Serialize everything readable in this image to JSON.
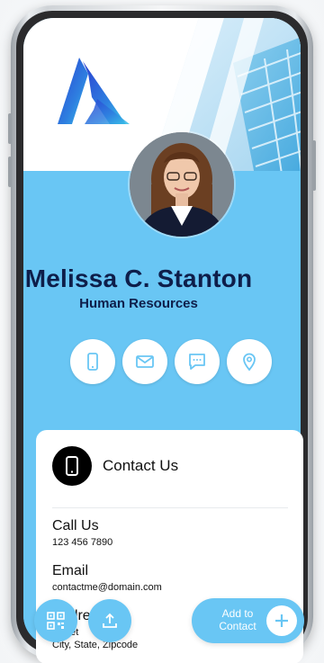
{
  "profile": {
    "name": "Melissa C. Stanton",
    "role": "Human Resources"
  },
  "actions": [
    {
      "icon": "phone-icon"
    },
    {
      "icon": "mail-icon"
    },
    {
      "icon": "chat-icon"
    },
    {
      "icon": "location-pin-icon"
    }
  ],
  "contact_card": {
    "title": "Contact Us",
    "call_label": "Call Us",
    "call_value": "123 456 7890",
    "email_label": "Email",
    "email_value": "contactme@domain.com",
    "address_label": "Address",
    "address_street": "Street",
    "address_city": "City, State, Zipcode"
  },
  "bottom_bar": {
    "add_contact_label": "Add to Contact"
  },
  "colors": {
    "accent": "#69c6f4",
    "name_text": "#0e1e4a",
    "card_bg": "#ffffff"
  }
}
